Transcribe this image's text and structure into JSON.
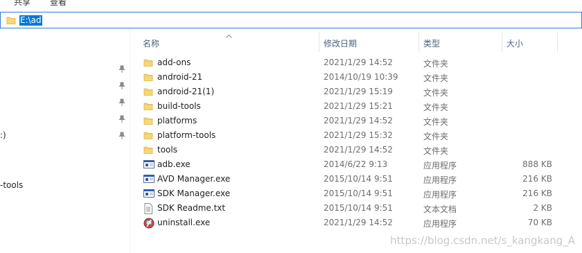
{
  "ribbon": {
    "tabs": [
      "共享",
      "查看"
    ]
  },
  "address_bar": {
    "path": "E:\\ad"
  },
  "nav_pane": {
    "items": [
      ":)",
      "-tools"
    ]
  },
  "columns": {
    "name": "名称",
    "date": "修改日期",
    "type": "类型",
    "size": "大小"
  },
  "files": [
    {
      "name": "add-ons",
      "date": "2021/1/29 14:52",
      "type": "文件夹",
      "size": "",
      "icon": "folder-icon"
    },
    {
      "name": "android-21",
      "date": "2014/10/19 10:39",
      "type": "文件夹",
      "size": "",
      "icon": "folder-icon"
    },
    {
      "name": "android-21(1)",
      "date": "2021/1/29 15:19",
      "type": "文件夹",
      "size": "",
      "icon": "folder-icon"
    },
    {
      "name": "build-tools",
      "date": "2021/1/29 15:21",
      "type": "文件夹",
      "size": "",
      "icon": "folder-icon"
    },
    {
      "name": "platforms",
      "date": "2021/1/29 14:52",
      "type": "文件夹",
      "size": "",
      "icon": "folder-icon"
    },
    {
      "name": "platform-tools",
      "date": "2021/1/29 15:32",
      "type": "文件夹",
      "size": "",
      "icon": "folder-icon"
    },
    {
      "name": "tools",
      "date": "2021/1/29 14:52",
      "type": "文件夹",
      "size": "",
      "icon": "folder-icon"
    },
    {
      "name": "adb.exe",
      "date": "2014/6/22 9:13",
      "type": "应用程序",
      "size": "888 KB",
      "icon": "exe-icon"
    },
    {
      "name": "AVD Manager.exe",
      "date": "2015/10/14 9:51",
      "type": "应用程序",
      "size": "216 KB",
      "icon": "exe-icon"
    },
    {
      "name": "SDK Manager.exe",
      "date": "2015/10/14 9:51",
      "type": "应用程序",
      "size": "216 KB",
      "icon": "exe-icon"
    },
    {
      "name": "SDK Readme.txt",
      "date": "2015/10/14 9:51",
      "type": "文本文档",
      "size": "2 KB",
      "icon": "text-file-icon"
    },
    {
      "name": "uninstall.exe",
      "date": "2021/1/29 14:52",
      "type": "应用程序",
      "size": "70 KB",
      "icon": "uninstall-icon"
    }
  ],
  "watermark": "https://blog.csdn.net/s_kangkang_A",
  "colors": {
    "selection": "#0078d7",
    "folder": "#f8d775",
    "header_text": "#4c607a"
  }
}
